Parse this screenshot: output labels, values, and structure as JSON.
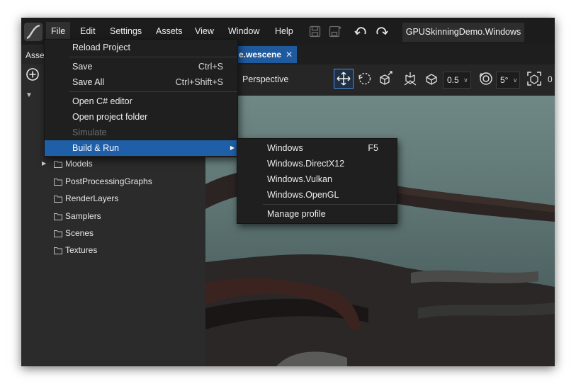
{
  "menubar": {
    "items": [
      "File",
      "Edit",
      "Settings",
      "Assets",
      "View",
      "Window",
      "Help"
    ],
    "project_name": "GPUSkinningDemo.Windows"
  },
  "assets_panel": {
    "title": "Asse",
    "tree": [
      "Models",
      "PostProcessingGraphs",
      "RenderLayers",
      "Samplers",
      "Scenes",
      "Textures"
    ]
  },
  "document_tab": {
    "label": "e.wescene",
    "close": "✕"
  },
  "viewport_toolbar": {
    "camera_mode": "Perspective",
    "scale_snap": "0.5",
    "rotation_snap": "5°",
    "extra_value": "0"
  },
  "file_menu": {
    "reload_project": "Reload Project",
    "save": "Save",
    "save_shortcut": "Ctrl+S",
    "save_all": "Save All",
    "save_all_shortcut": "Ctrl+Shift+S",
    "open_csharp_editor": "Open C# editor",
    "open_project_folder": "Open project folder",
    "simulate": "Simulate",
    "build_and_run": "Build & Run"
  },
  "build_submenu": {
    "windows": "Windows",
    "windows_shortcut": "F5",
    "directx12": "Windows.DirectX12",
    "vulkan": "Windows.Vulkan",
    "opengl": "Windows.OpenGL",
    "manage_profile": "Manage profile"
  },
  "colors": {
    "accent": "#1f5fa8",
    "menubar_bg": "#1c1c1c",
    "panel_bg": "#2b2b2b",
    "menu_bg": "#1f1f1f"
  },
  "icons": [
    "app-logo-icon",
    "save-icon",
    "save-all-icon",
    "undo-icon",
    "redo-icon",
    "add-circle-icon",
    "folder-icon",
    "move-gizmo-icon",
    "rotate-gizmo-icon",
    "scale-gizmo-icon",
    "pivot-icon",
    "snap-scale-icon",
    "snap-rotation-icon",
    "frame-icon"
  ]
}
